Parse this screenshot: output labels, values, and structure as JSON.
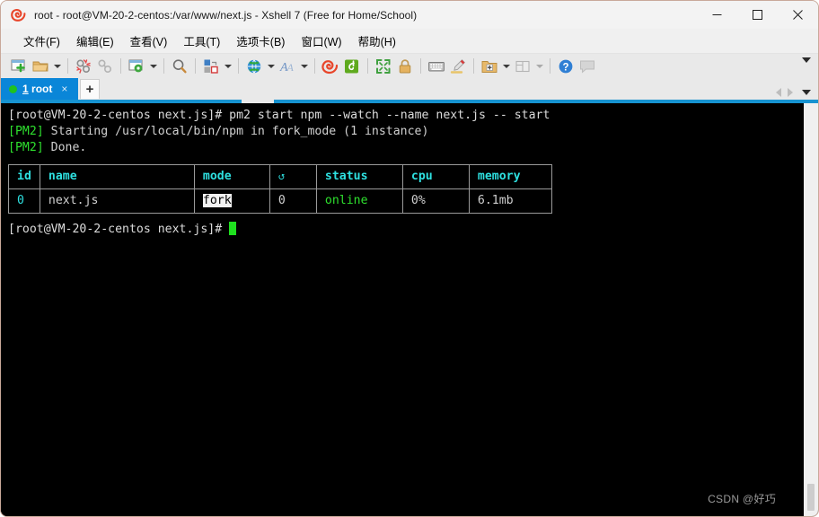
{
  "window": {
    "title": "root - root@VM-20-2-centos:/var/www/next.js - Xshell 7 (Free for Home/School)",
    "app_icon": "xshell-shell-icon",
    "controls": {
      "minimize": "minimize-icon",
      "maximize": "maximize-icon",
      "close": "close-icon"
    },
    "border_color": "#c9a99a"
  },
  "menubar": {
    "items": [
      {
        "label": "文件(F)",
        "name": "menu-file"
      },
      {
        "label": "编辑(E)",
        "name": "menu-edit"
      },
      {
        "label": "查看(V)",
        "name": "menu-view"
      },
      {
        "label": "工具(T)",
        "name": "menu-tools"
      },
      {
        "label": "选项卡(B)",
        "name": "menu-tabs"
      },
      {
        "label": "窗口(W)",
        "name": "menu-window"
      },
      {
        "label": "帮助(H)",
        "name": "menu-help"
      }
    ]
  },
  "toolbar": {
    "buttons": [
      "new-session-icon",
      "open-folder-icon",
      "disconnect-icon",
      "reconnect-icon",
      "session-properties-icon",
      "find-icon",
      "copy-session-icon",
      "web-browser-icon",
      "font-icon",
      "xshell-logo-icon",
      "xftp-icon",
      "fullscreen-icon",
      "lock-icon",
      "keyboard-icon",
      "highlight-pen-icon",
      "add-folder-icon",
      "layout-icon",
      "help-icon",
      "feedback-icon"
    ],
    "overflow": "toolbar-overflow-caret"
  },
  "tabbar": {
    "active_tab": {
      "mnemonic": "1",
      "label": " root",
      "status_color": "#1fc21f",
      "close": "×"
    },
    "new_tab": "+",
    "nav_prev": "tab-prev-arrow",
    "nav_next": "tab-next-arrow",
    "overflow": "tab-overflow-caret"
  },
  "terminal": {
    "prompt": "[root@VM-20-2-centos next.js]# ",
    "command": "pm2 start npm --watch --name next.js -- start",
    "lines": [
      {
        "tag": "[PM2]",
        "rest": " Starting /usr/local/bin/npm in fork_mode (1 instance)"
      },
      {
        "tag": "[PM2]",
        "rest": " Done."
      }
    ],
    "final_prompt": "[root@VM-20-2-centos next.js]# ",
    "cursor": "block-cursor",
    "colors": {
      "background": "#000000",
      "foreground": "#d8d8d8",
      "green": "#2ee02e",
      "cyan": "#2ee0e0",
      "selection_bg": "#f2f2f2"
    }
  },
  "pm2_table": {
    "headers": [
      "id",
      "name",
      "mode",
      "↺",
      "status",
      "cpu",
      "memory"
    ],
    "rows": [
      {
        "id": "0",
        "name": "next.js",
        "mode": "fork",
        "restarts": "0",
        "status": "online",
        "cpu": "0%",
        "memory": "6.1mb"
      }
    ],
    "selected_cell": "mode"
  },
  "watermark": {
    "text": "CSDN @好巧"
  }
}
